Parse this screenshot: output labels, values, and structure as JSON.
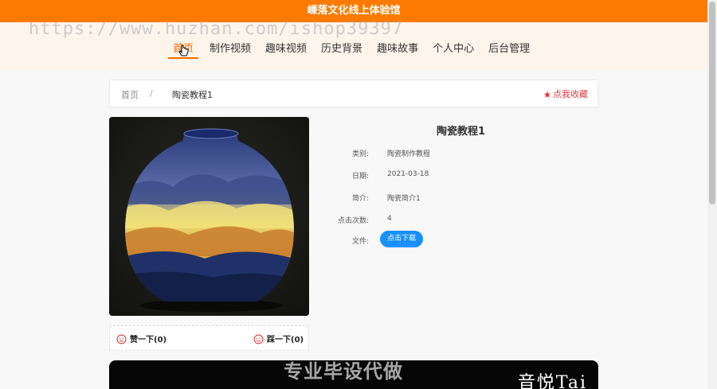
{
  "header": {
    "title": "嵊落文化线上体验馆"
  },
  "watermark": "https://www.huzhan.com/ishop39397",
  "nav": {
    "items": [
      {
        "label": "首页",
        "active": true
      },
      {
        "label": "制作视频",
        "active": false
      },
      {
        "label": "趣味视频",
        "active": false
      },
      {
        "label": "历史背景",
        "active": false
      },
      {
        "label": "趣味故事",
        "active": false
      },
      {
        "label": "个人中心",
        "active": false
      },
      {
        "label": "后台管理",
        "active": false
      }
    ]
  },
  "breadcrumb": {
    "home": "首页",
    "separator": "/",
    "current": "陶瓷教程1"
  },
  "favorite": {
    "label": "点我收藏",
    "icon": "star-icon",
    "color": "#e4393c"
  },
  "detail": {
    "title": "陶瓷教程1",
    "fields": [
      {
        "label": "类别:",
        "value": "陶瓷制作教程"
      },
      {
        "label": "日期:",
        "value": "2021-03-18"
      },
      {
        "label": "简介:",
        "value": "陶瓷简介1"
      },
      {
        "label": "点击次数:",
        "value": "4"
      }
    ],
    "file_label": "文件:",
    "download_label": "点击下载"
  },
  "votes": {
    "like_label": "赞一下(0)",
    "dislike_label": "踩一下(0)",
    "icon": "smile-icon"
  },
  "video": {
    "overlay_text": "音悦Tai"
  },
  "overlay_watermark": "专业毕设代做",
  "colors": {
    "accent": "#ff7a00",
    "download": "#1890ff"
  }
}
